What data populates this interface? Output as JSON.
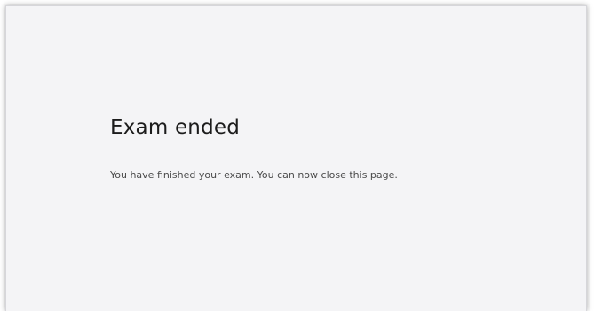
{
  "page": {
    "heading": "Exam ended",
    "message": "You have finished your exam. You can now close this page."
  }
}
